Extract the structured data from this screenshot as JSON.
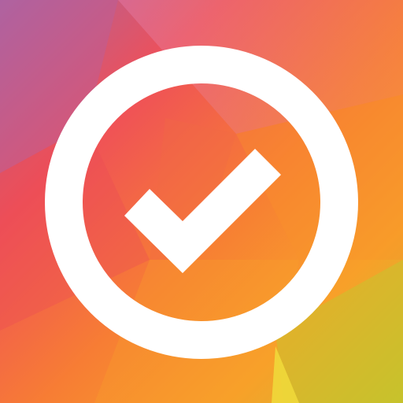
{
  "app_icon": {
    "icon": "check-circle-icon",
    "colors": {
      "purple": "#b0649a",
      "pink_red": "#ea4c5a",
      "coral": "#f2684a",
      "orange": "#f7862e",
      "amber": "#f9a42a",
      "yellow": "#e9c22c",
      "lime": "#b9c12e",
      "white": "#ffffff"
    }
  }
}
